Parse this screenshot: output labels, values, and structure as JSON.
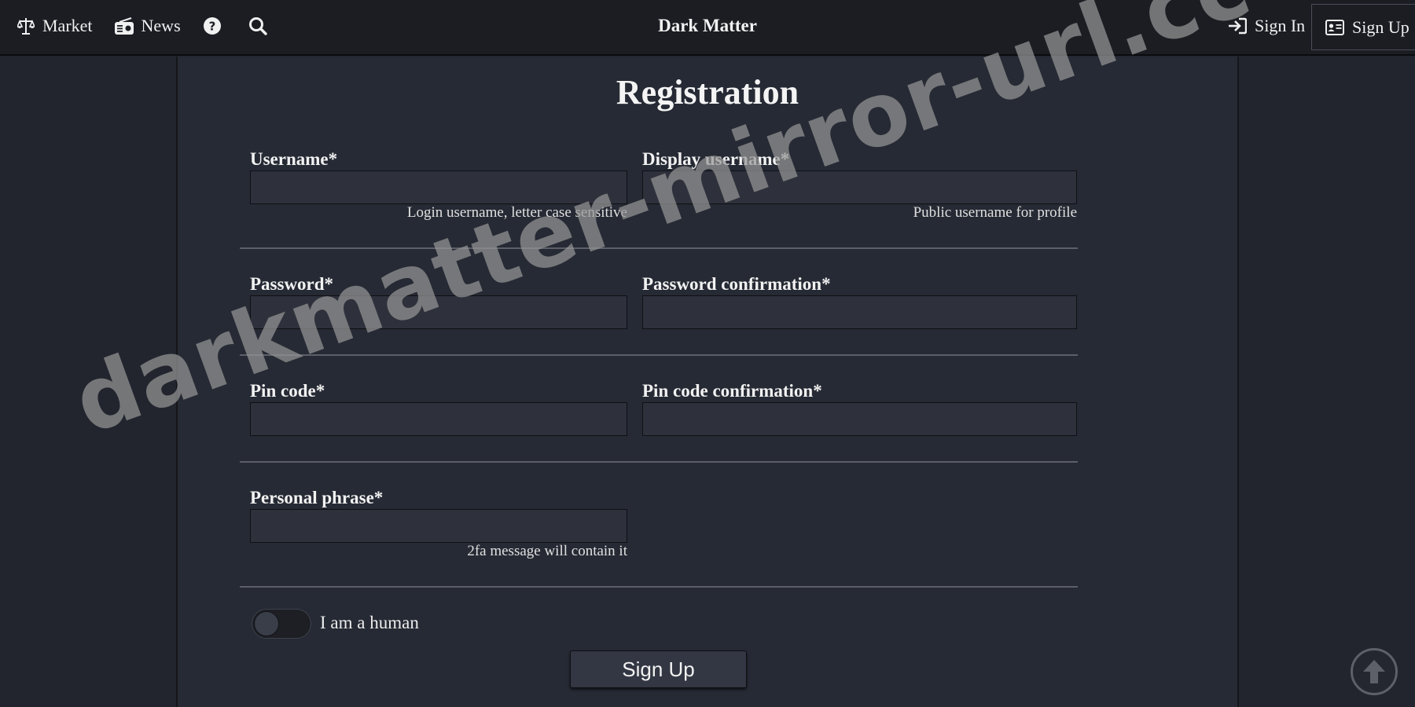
{
  "nav": {
    "market": "Market",
    "news": "News",
    "brand": "Dark Matter",
    "sign_in": "Sign In",
    "sign_up": "Sign Up"
  },
  "page": {
    "title": "Registration"
  },
  "form": {
    "username": {
      "label": "Username*",
      "value": "",
      "hint": "Login username, letter case sensitive"
    },
    "display_username": {
      "label": "Display username*",
      "value": "",
      "hint": "Public username for profile"
    },
    "password": {
      "label": "Password*",
      "value": ""
    },
    "password_confirmation": {
      "label": "Password confirmation*",
      "value": ""
    },
    "pin_code": {
      "label": "Pin code*",
      "value": ""
    },
    "pin_code_confirmation": {
      "label": "Pin code confirmation*",
      "value": ""
    },
    "personal_phrase": {
      "label": "Personal phrase*",
      "value": "",
      "hint": "2fa message will contain it"
    },
    "human_check": {
      "label": "I am a human",
      "checked": false
    },
    "submit_label": "Sign Up"
  },
  "watermark": "darkmatter-mirror-url.cc",
  "icons": {
    "market": "scale-icon",
    "news": "radio-icon",
    "help": "question-circle-icon",
    "search": "search-icon",
    "sign_in": "sign-in-icon",
    "sign_up": "id-card-icon",
    "scroll_top": "arrow-up-circle-icon"
  },
  "colors": {
    "background": "#22252e",
    "topbar": "#1b1d23",
    "panel": "#262a34",
    "input": "#2e313b",
    "button": "#333743"
  }
}
